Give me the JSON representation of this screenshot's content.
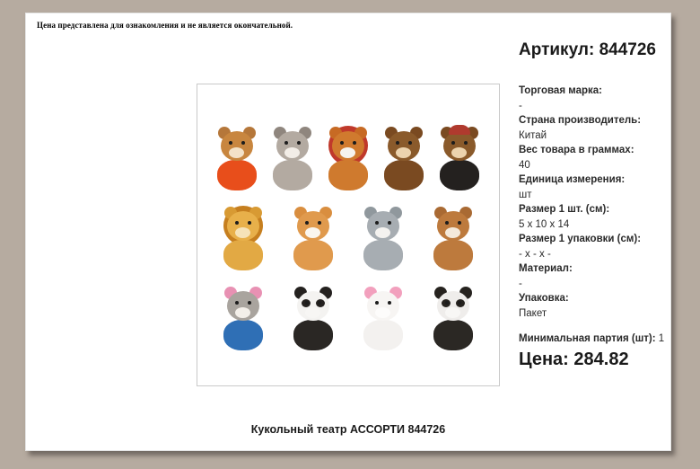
{
  "disclaimer": "Цена представлена для ознакомления и не является окончательной.",
  "header": {
    "article_heading": "Артикул: 844726"
  },
  "details": {
    "items": [
      {
        "label": "Торговая марка:",
        "value": "-"
      },
      {
        "label": "Страна производитель:",
        "value": "Китай"
      },
      {
        "label": "Вес товара в граммах:",
        "value": "40"
      },
      {
        "label": "Единица измерения:",
        "value": "шт"
      },
      {
        "label": "Размер 1 шт. (см):",
        "value": "5 x 10 x 14"
      },
      {
        "label": "Размер 1 упаковки (см):",
        "value": "- x - x -"
      },
      {
        "label": "Материал:",
        "value": "-"
      },
      {
        "label": "Упаковка:",
        "value": "Пакет"
      }
    ]
  },
  "min_batch": {
    "label": "Минимальная партия (шт):",
    "value": "1"
  },
  "price": {
    "label": "Цена:",
    "value": "284.82"
  },
  "product_title": "Кукольный театр АССОРТИ 844726",
  "colors": {
    "desktop_bg": "#b6aba0",
    "page_bg": "#ffffff",
    "image_border": "#c9c9c9",
    "text": "#1d1d1d"
  },
  "product_image": {
    "description": "Assorted plush animal hand toys, 13 items in 3 rows",
    "rows": [
      [
        {
          "name": "teddy-bear-orange-shirt",
          "ears": "#b5773a",
          "head": "#c8863f",
          "muzzle": "#f3e2c8",
          "body": "#e84e1b"
        },
        {
          "name": "gray-hamster",
          "ears": "#8f867e",
          "head": "#b3aaa1",
          "muzzle": "#f2ede7",
          "body": "#b3aaa1"
        },
        {
          "name": "orange-horse",
          "ears": "#c76a24",
          "head": "#d07a2e",
          "muzzle": "#f6f3ee",
          "body": "#cf7a2e",
          "mane": "#c0392b"
        },
        {
          "name": "brown-monkey",
          "ears": "#7a4a21",
          "head": "#8a5a2b",
          "muzzle": "#ecd3ae",
          "body": "#7a4a21"
        },
        {
          "name": "pirate-monkey",
          "ears": "#7a4a21",
          "head": "#8a5a2b",
          "muzzle": "#ecd3ae",
          "body": "#24211f",
          "hat": "#b03a2e"
        }
      ],
      [
        {
          "name": "lion",
          "ears": "#d89a33",
          "head": "#e8b04a",
          "muzzle": "#f6e3b8",
          "body": "#e2a944",
          "mane": "#c67f1f"
        },
        {
          "name": "tabby-cat",
          "ears": "#d98e3f",
          "head": "#e09a4d",
          "muzzle": "#faf6ef",
          "body": "#e09a4d"
        },
        {
          "name": "gray-hamster-2",
          "ears": "#90989d",
          "head": "#a7adb2",
          "muzzle": "#f4f2ef",
          "body": "#a7adb2"
        },
        {
          "name": "brown-hamster",
          "ears": "#a96a33",
          "head": "#bd7a3d",
          "muzzle": "#f4e9da",
          "body": "#bd7a3d"
        }
      ],
      [
        {
          "name": "cat-blue-sweater",
          "ears": "#e891b3",
          "head": "#a9a49e",
          "muzzle": "#f3efe9",
          "body": "#2f6fb5"
        },
        {
          "name": "panda",
          "ears": "#24211f",
          "head": "#f4f3f1",
          "muzzle": "#f7f6f4",
          "body": "#2a2724",
          "patches": "#24211f"
        },
        {
          "name": "white-hamster",
          "ears": "#f2a0bd",
          "head": "#f7f5f3",
          "muzzle": "#fdfcfb",
          "body": "#f3f1ef"
        },
        {
          "name": "husky",
          "ears": "#26231f",
          "head": "#efedeb",
          "muzzle": "#f8f7f5",
          "body": "#2b2824",
          "patches": "#26231f"
        }
      ]
    ]
  }
}
